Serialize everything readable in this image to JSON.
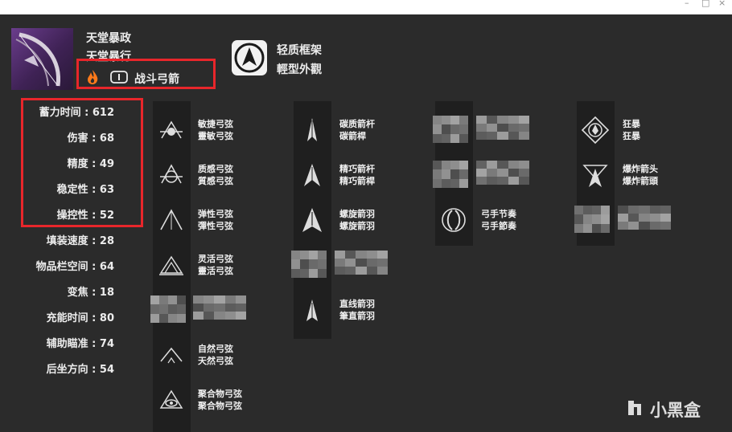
{
  "window": {
    "minimize": "–",
    "maximize": "□",
    "close": "×"
  },
  "weapon": {
    "name_simplified": "天堂暴政",
    "name_traditional": "天堂暴行",
    "type": "战斗弓箭",
    "element_icon": "solar-flame-icon",
    "ammo_icon": "primary-ammo-icon",
    "accent_color": "#e8262b"
  },
  "frame": {
    "name_simplified": "轻质框架",
    "name_traditional": "輕型外觀",
    "icon": "lightweight-frame-icon"
  },
  "stats": [
    {
      "label": "蓄力时间",
      "value": "612"
    },
    {
      "label": "伤害",
      "value": "68"
    },
    {
      "label": "精度",
      "value": "49"
    },
    {
      "label": "稳定性",
      "value": "63"
    },
    {
      "label": "操控性",
      "value": "52"
    },
    {
      "label": "填装速度",
      "value": "28"
    },
    {
      "label": "物品栏空间",
      "value": "64"
    },
    {
      "label": "变焦",
      "value": "18"
    },
    {
      "label": "充能时间",
      "value": "80"
    },
    {
      "label": "辅助瞄准",
      "value": "74"
    },
    {
      "label": "后坐方向",
      "value": "54"
    }
  ],
  "strings": [
    {
      "simplified": "敏捷弓弦",
      "traditional": "靈敏弓弦",
      "icon": "string-agile-icon"
    },
    {
      "simplified": "质感弓弦",
      "traditional": "質感弓弦",
      "icon": "string-textured-icon"
    },
    {
      "simplified": "弹性弓弦",
      "traditional": "彈性弓弦",
      "icon": "string-elastic-icon"
    },
    {
      "simplified": "灵活弓弦",
      "traditional": "靈活弓弦",
      "icon": "string-flexible-icon"
    },
    {
      "simplified": "",
      "traditional": "",
      "icon": "censored-perk"
    },
    {
      "simplified": "自然弓弦",
      "traditional": "天然弓弦",
      "icon": "string-natural-icon"
    },
    {
      "simplified": "聚合物弓弦",
      "traditional": "聚合物弓弦",
      "icon": "string-polymer-icon"
    }
  ],
  "arrows": [
    {
      "simplified": "碳质箭杆",
      "traditional": "碳箭桿",
      "icon": "arrow-carbon-icon"
    },
    {
      "simplified": "精巧箭杆",
      "traditional": "精巧箭桿",
      "icon": "arrow-compact-icon"
    },
    {
      "simplified": "螺旋箭羽",
      "traditional": "螺旋箭羽",
      "icon": "arrow-helical-icon"
    },
    {
      "simplified": "",
      "traditional": "",
      "icon": "censored-perk"
    },
    {
      "simplified": "直线箭羽",
      "traditional": "筆直箭羽",
      "icon": "arrow-straight-icon"
    }
  ],
  "trait1": [
    {
      "simplified": "",
      "traditional": "",
      "icon": "censored-perk"
    },
    {
      "simplified": "",
      "traditional": "",
      "icon": "censored-perk"
    },
    {
      "simplified": "弓手节奏",
      "traditional": "弓手節奏",
      "icon": "archers-tempo-icon"
    }
  ],
  "trait2": [
    {
      "simplified": "狂暴",
      "traditional": "狂暴",
      "icon": "rampage-icon"
    },
    {
      "simplified": "爆炸箭头",
      "traditional": "爆炸箭頭",
      "icon": "explosive-head-icon"
    },
    {
      "simplified": "",
      "traditional": "",
      "icon": "censored-perk"
    }
  ],
  "watermark": {
    "text": "小黑盒",
    "icon": "xiaoheihe-logo-icon"
  }
}
